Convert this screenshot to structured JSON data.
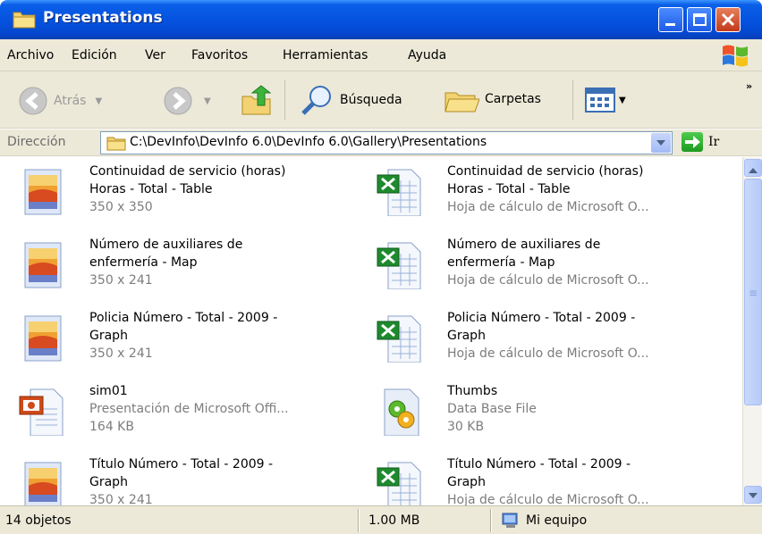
{
  "window": {
    "title": "Presentations"
  },
  "menu": {
    "items": [
      {
        "label": "Archivo"
      },
      {
        "label": "Edición"
      },
      {
        "label": "Ver"
      },
      {
        "label": "Favoritos"
      },
      {
        "label": "Herramientas"
      },
      {
        "label": "Ayuda"
      }
    ]
  },
  "toolbar": {
    "back": "Atrás",
    "search": "Búsqueda",
    "folders": "Carpetas",
    "more": "»"
  },
  "address": {
    "label": "Dirección",
    "path": "C:\\DevInfo\\DevInfo 6.0\\DevInfo 6.0\\Gallery\\Presentations",
    "go": "Ir"
  },
  "files": [
    {
      "line1": "Continuidad de servicio (horas)",
      "line2": "Horas - Total - Table",
      "line3": "350 x 350",
      "icon": "image-icon"
    },
    {
      "line1": "Continuidad de servicio (horas)",
      "line2": "Horas - Total - Table",
      "line3": "Hoja de cálculo de Microsoft O...",
      "icon": "excel-icon"
    },
    {
      "line1": "Número de auxiliares de",
      "line2": "enfermería  - Map",
      "line3": "350 x 241",
      "icon": "image-icon"
    },
    {
      "line1": "Número de auxiliares de",
      "line2": "enfermería  - Map",
      "line3": "Hoja de cálculo de Microsoft O...",
      "icon": "excel-icon"
    },
    {
      "line1": "Policia Número - Total - 2009 -",
      "line2": "Graph",
      "line3": "350 x 241",
      "icon": "image-icon"
    },
    {
      "line1": "Policia Número - Total - 2009 -",
      "line2": "Graph",
      "line3": "Hoja de cálculo de Microsoft O...",
      "icon": "excel-icon"
    },
    {
      "line1": "sim01",
      "line2": "Presentación de Microsoft Offi...",
      "line3": "164 KB",
      "icon": "powerpoint-icon"
    },
    {
      "line1": "Thumbs",
      "line2": "Data Base File",
      "line3": "30 KB",
      "icon": "database-icon"
    },
    {
      "line1": "Título Número - Total - 2009 -",
      "line2": "Graph",
      "line3": "350 x 241",
      "icon": "image-icon"
    },
    {
      "line1": "Título Número - Total - 2009 -",
      "line2": "Graph",
      "line3": "Hoja de cálculo de Microsoft O...",
      "icon": "excel-icon"
    }
  ],
  "status": {
    "count": "14 objetos",
    "size": "1.00 MB",
    "zone": "Mi equipo"
  }
}
